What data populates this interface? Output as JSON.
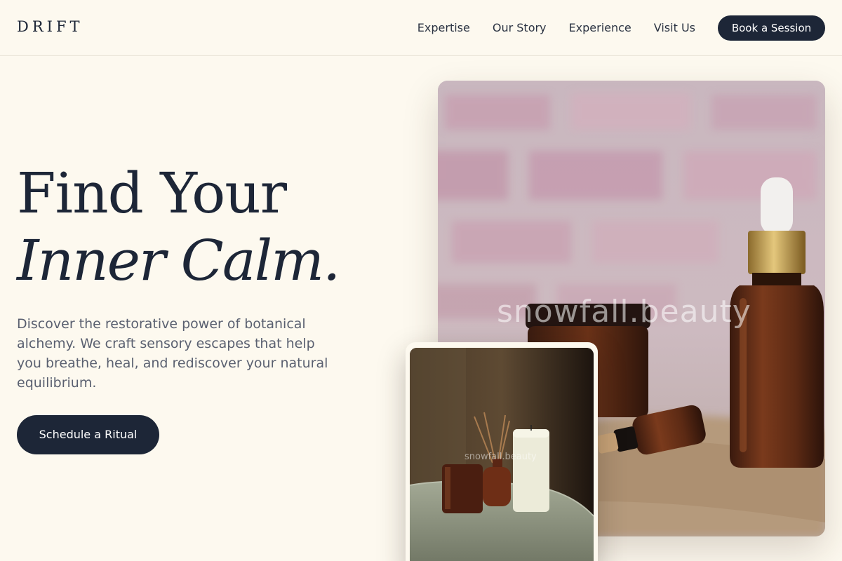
{
  "header": {
    "logo": "DRIFT",
    "nav": [
      "Expertise",
      "Our Story",
      "Experience",
      "Visit Us"
    ],
    "cta": "Book a Session"
  },
  "hero": {
    "title_line1": "Find Your",
    "title_line2": "Inner Calm.",
    "description": "Discover the restorative power of botanical alchemy. We craft sensory escapes that help you breathe, heal, and rediscover your natural equilibrium.",
    "cta": "Schedule a Ritual"
  },
  "images": {
    "main_watermark": "snowfall.beauty",
    "secondary_watermark": "snowfall.beauty"
  },
  "colors": {
    "background": "#fdf9ef",
    "accent": "#1d2637",
    "text_muted": "#5a6070"
  }
}
